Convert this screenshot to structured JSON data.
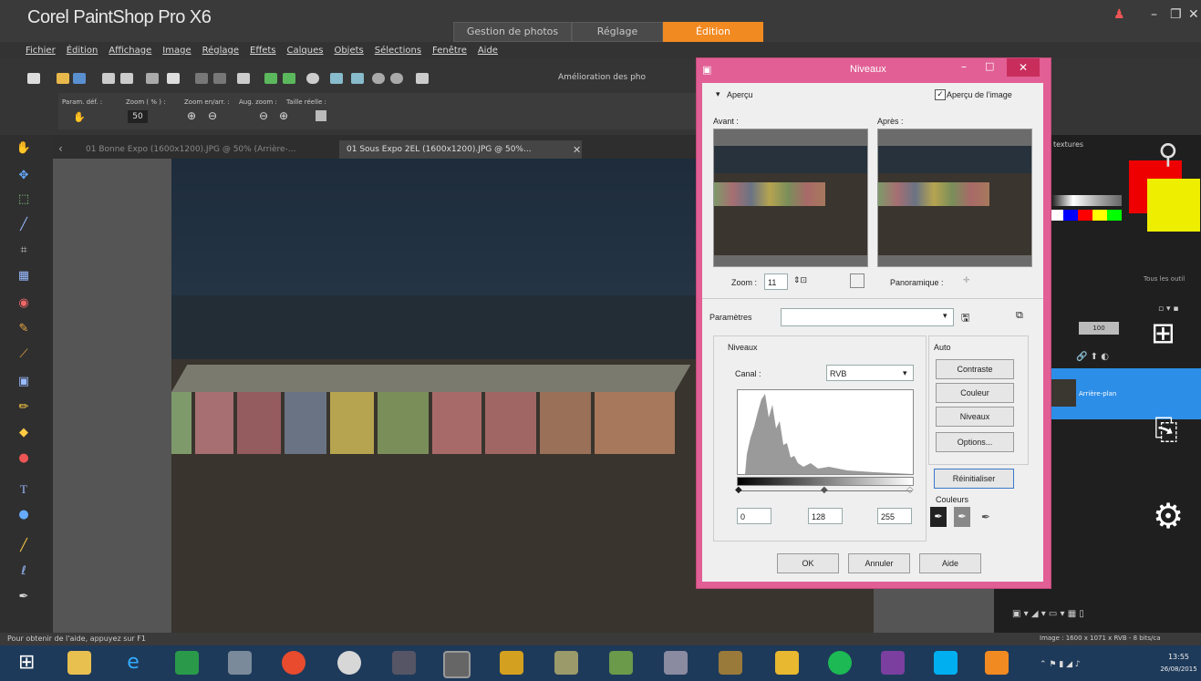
{
  "app": {
    "title": "Corel PaintShop Pro X6",
    "workspace_tabs": [
      "Gestion de photos",
      "Réglage",
      "Édition"
    ],
    "active_tab": "Édition"
  },
  "menu": [
    "Fichier",
    "Édition",
    "Affichage",
    "Image",
    "Réglage",
    "Effets",
    "Calques",
    "Objets",
    "Sélections",
    "Fenêtre",
    "Aide"
  ],
  "toolbar": {
    "enhance_label": "Amélioration des pho",
    "pan_label": "Param. déf. :",
    "zoom_pct_label": "Zoom ( % ) :",
    "zoom_inout_label": "Zoom en/arr. :",
    "zoom_aug_label": "Aug. zoom :",
    "actual_size_label": "Taille réelle :",
    "zoom_value": "50"
  },
  "documents": [
    {
      "title": "01 Bonne Expo (1600x1200).JPG @ 50% (Arrière-...",
      "active": false
    },
    {
      "title": "01 Sous Expo 2EL (1600x1200).JPG @ 50%...",
      "active": true
    }
  ],
  "right_panel": {
    "textures_label": "textures",
    "all_tools_label": "Tous les outil",
    "opacity_value": "100",
    "layer_name": "Arrière-plan"
  },
  "status": {
    "help": "Pour obtenir de l'aide, appuyez sur F1",
    "image_info": "Image : 1600 x 1071 x RVB - 8 bits/ca"
  },
  "clock": {
    "time": "13:55",
    "date": "26/08/2015"
  },
  "dialog": {
    "title": "Niveaux",
    "preview_section": "Aperçu",
    "preview_checkbox": "Aperçu de l'image",
    "before_label": "Avant :",
    "after_label": "Après :",
    "zoom_label": "Zoom :",
    "zoom_value": "11",
    "panoramic_label": "Panoramique :",
    "params_label": "Paramètres",
    "levels_group": "Niveaux",
    "channel_label": "Canal :",
    "channel_value": "RVB",
    "auto_group": "Auto",
    "btn_contrast": "Contraste",
    "btn_color": "Couleur",
    "btn_levels": "Niveaux",
    "btn_options": "Options...",
    "btn_reset": "Réinitialiser",
    "colors_label": "Couleurs",
    "input_black": "0",
    "input_mid": "128",
    "input_white": "255",
    "btn_ok": "OK",
    "btn_cancel": "Annuler",
    "btn_help": "Aide"
  }
}
